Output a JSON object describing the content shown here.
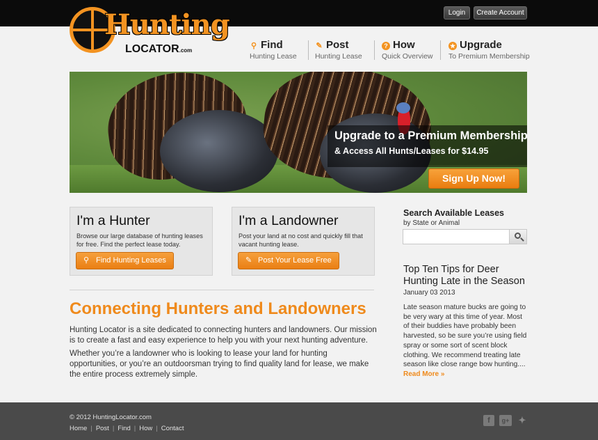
{
  "header": {
    "login_label": "Login",
    "create_account_label": "Create Account",
    "logo_word": "Hunting",
    "logo_sub": "LOCATOR",
    "logo_dotcom": ".com"
  },
  "nav": [
    {
      "title": "Find",
      "sub": "Hunting Lease",
      "icon": "search-icon"
    },
    {
      "title": "Post",
      "sub": "Hunting Lease",
      "icon": "edit-icon"
    },
    {
      "title": "How",
      "sub": "Quick Overview",
      "icon": "question-icon"
    },
    {
      "title": "Upgrade",
      "sub": "To Premium Membership",
      "icon": "star-badge-icon"
    }
  ],
  "banner": {
    "heading": "Upgrade to a Premium Membership",
    "subheading": "& Access All Hunts/Leases for $14.95",
    "cta_label": "Sign Up Now!"
  },
  "hunter_card": {
    "title": "I'm a Hunter",
    "text": "Browse our large database of hunting leases for free. Find the perfect lease today.",
    "button_label": "Find Hunting Leases"
  },
  "landowner_card": {
    "title": "I'm a Landowner",
    "text": "Post your land at no cost and quickly fill that vacant hunting lease.",
    "button_label": "Post Your Lease Free"
  },
  "main": {
    "heading": "Connecting Hunters and Landowners",
    "para1": "Hunting Locator is a site dedicated to connecting hunters and landowners. Our mission is to create a fast and easy experience to help you with your next hunting adventure.",
    "para2": "Whether you’re a landowner who is looking to lease your land for hunting opportunities, or you’re an outdoorsman trying to find quality land for lease, we make the entire process extremely simple."
  },
  "sidebar": {
    "search_title": "Search Available Leases",
    "search_sub": "by State or Animal",
    "search_placeholder": "",
    "tip_title": "Top Ten Tips for Deer Hunting Late in the Season",
    "tip_date": "January 03 2013",
    "tip_body": "Late season mature bucks are going to be very wary at this time of year. Most of their buddies have probably been harvested, so be sure you’re using field spray or some sort of scent block clothing. We recommend treating late season like close range bow hunting....",
    "read_more": "Read More »"
  },
  "footer": {
    "copyright": "© 2012 HuntingLocator.com",
    "links": [
      "Home",
      "Post",
      "Find",
      "How",
      "Contact"
    ],
    "social": [
      "facebook-icon",
      "google-plus-icon",
      "twitter-icon"
    ]
  },
  "colors": {
    "accent": "#ef8a1c",
    "topbar": "#0b0b0b",
    "footer": "#4a4a4a"
  }
}
